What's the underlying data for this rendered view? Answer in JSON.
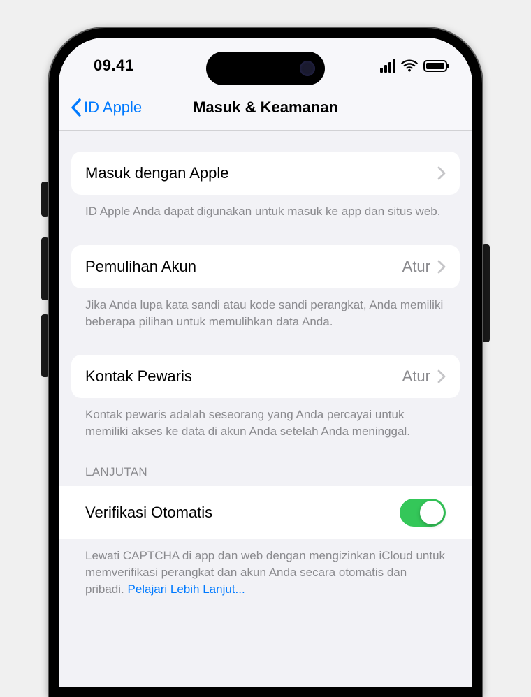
{
  "status": {
    "time": "09.41"
  },
  "nav": {
    "back": "ID Apple",
    "title": "Masuk & Keamanan"
  },
  "rows": {
    "signin": {
      "label": "Masuk dengan Apple",
      "footer": "ID Apple Anda dapat digunakan untuk masuk ke app dan situs web."
    },
    "recovery": {
      "label": "Pemulihan Akun",
      "value": "Atur",
      "footer": "Jika Anda lupa kata sandi atau kode sandi perangkat, Anda memiliki beberapa pilihan untuk memulihkan data Anda."
    },
    "legacy": {
      "label": "Kontak Pewaris",
      "value": "Atur",
      "footer": "Kontak pewaris adalah seseorang yang Anda percayai untuk memiliki akses ke data di akun Anda setelah Anda meninggal."
    },
    "advanced": {
      "header": "LANJUTAN",
      "autoverify_label": "Verifikasi Otomatis",
      "autoverify_footer": "Lewati CAPTCHA di app dan web dengan mengizinkan iCloud untuk memverifikasi perangkat dan akun Anda secara otomatis dan pribadi. ",
      "autoverify_link": "Pelajari Lebih Lanjut..."
    }
  }
}
